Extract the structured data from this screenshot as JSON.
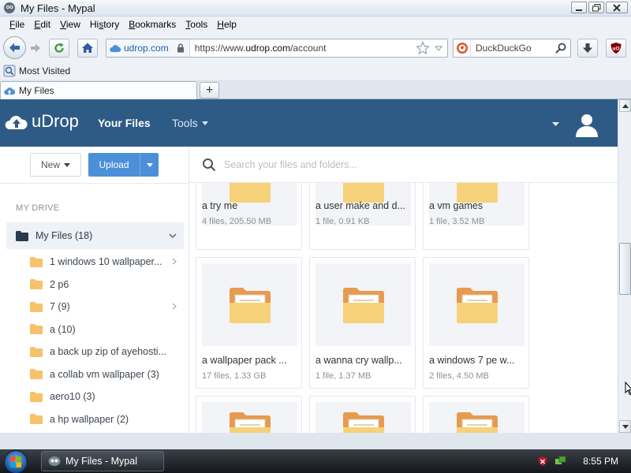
{
  "window": {
    "title": "My Files - Mypal"
  },
  "menu": [
    {
      "pre": "",
      "u": "F",
      "post": "ile"
    },
    {
      "pre": "",
      "u": "E",
      "post": "dit"
    },
    {
      "pre": "",
      "u": "V",
      "post": "iew"
    },
    {
      "pre": "Hi",
      "u": "s",
      "post": "tory"
    },
    {
      "pre": "",
      "u": "B",
      "post": "ookmarks"
    },
    {
      "pre": "",
      "u": "T",
      "post": "ools"
    },
    {
      "pre": "",
      "u": "H",
      "post": "elp"
    }
  ],
  "nav": {
    "site_identity": "udrop.com",
    "url_prefix": "https://www.",
    "url_domain": "udrop.com",
    "url_path": "/account",
    "search_engine": "DuckDuckGo"
  },
  "bookmarks": {
    "most_visited": "Most Visited"
  },
  "tab": {
    "title": "My Files",
    "new_tab": "+"
  },
  "app": {
    "logo": "uDrop",
    "nav_your_files": "Your Files",
    "nav_tools": "Tools",
    "brand_color": "#2e5b86",
    "accent_color": "#4c8fd9"
  },
  "sidebar": {
    "new_label": "New",
    "upload_label": "Upload",
    "section_label": "MY DRIVE",
    "my_files": "My Files (18)",
    "folders": [
      {
        "label": "1 windows 10 wallpaper...",
        "expandable": true
      },
      {
        "label": "2 p6",
        "expandable": false
      },
      {
        "label": "7 (9)",
        "expandable": true
      },
      {
        "label": "a (10)",
        "expandable": false
      },
      {
        "label": "a back up zip of ayehosti...",
        "expandable": false
      },
      {
        "label": "a collab vm wallpaper (3)",
        "expandable": false
      },
      {
        "label": "aero10 (3)",
        "expandable": false
      },
      {
        "label": "a hp wallpaper (2)",
        "expandable": false
      }
    ]
  },
  "search": {
    "placeholder": "Search your files and folders..."
  },
  "files": [
    {
      "name": "a try me",
      "meta": "4 files, 205.50 MB"
    },
    {
      "name": "a user make and d...",
      "meta": "1 file, 0.91 KB"
    },
    {
      "name": "a vm games",
      "meta": "1 file, 3.52 MB"
    },
    {
      "name": "a wallpaper pack ...",
      "meta": "17 files, 1.33 GB"
    },
    {
      "name": "a wanna cry wallp...",
      "meta": "1 file, 1.37 MB"
    },
    {
      "name": "a windows 7 pe w...",
      "meta": "2 files, 4.50 MB"
    },
    {
      "name": "",
      "meta": ""
    },
    {
      "name": "",
      "meta": ""
    },
    {
      "name": "",
      "meta": ""
    }
  ],
  "taskbar": {
    "task_title": "My Files - Mypal",
    "clock": "8:55 PM"
  }
}
